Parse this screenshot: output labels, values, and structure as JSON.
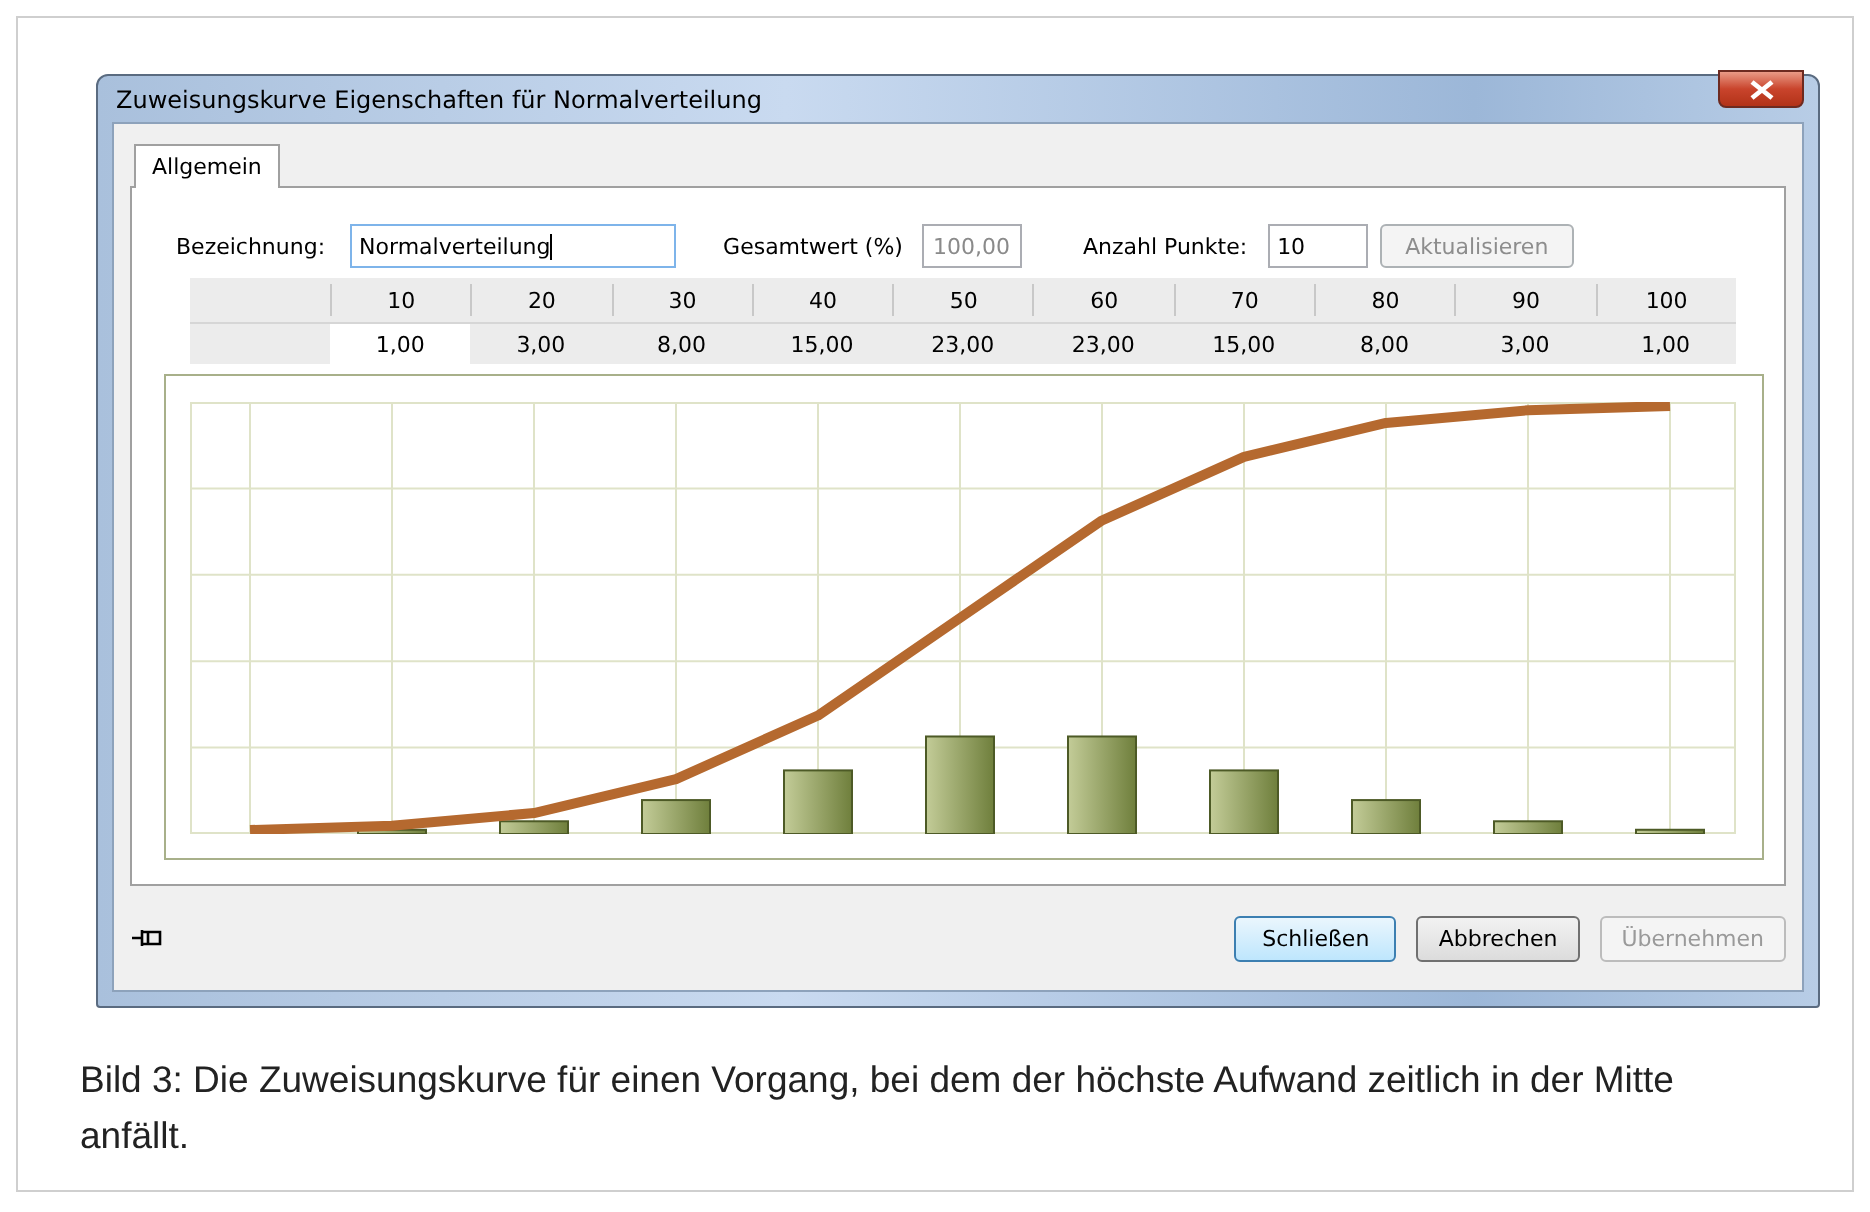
{
  "window": {
    "title": "Zuweisungskurve Eigenschaften für Normalverteilung"
  },
  "tabs": [
    {
      "label": "Allgemein",
      "selected": true
    }
  ],
  "form": {
    "name_label": "Bezeichnung:",
    "name_value": "Normalverteilung",
    "total_label": "Gesamtwert (%)",
    "total_value": "100,00",
    "points_label": "Anzahl Punkte:",
    "points_value": "10",
    "update_button": {
      "label": "Aktualisieren",
      "disabled": true
    }
  },
  "table": {
    "columns": [
      "10",
      "20",
      "30",
      "40",
      "50",
      "60",
      "70",
      "80",
      "90",
      "100"
    ],
    "cells": [
      {
        "text": "1,00",
        "selected": true
      },
      {
        "text": "3,00",
        "selected": false
      },
      {
        "text": "8,00",
        "selected": false
      },
      {
        "text": "15,00",
        "selected": false
      },
      {
        "text": "23,00",
        "selected": false
      },
      {
        "text": "23,00",
        "selected": false
      },
      {
        "text": "15,00",
        "selected": false
      },
      {
        "text": "8,00",
        "selected": false
      },
      {
        "text": "3,00",
        "selected": false
      },
      {
        "text": "1,00",
        "selected": false
      }
    ]
  },
  "buttons": [
    {
      "label": "Schließen",
      "kind": "default",
      "disabled": false
    },
    {
      "label": "Abbrechen",
      "kind": "normal",
      "disabled": false
    },
    {
      "label": "Übernehmen",
      "kind": "normal",
      "disabled": true
    }
  ],
  "caption": "Bild 3: Die Zuweisungskurve für einen Vorgang, bei dem der höchste Aufwand zeitlich in der Mitte anfällt."
}
